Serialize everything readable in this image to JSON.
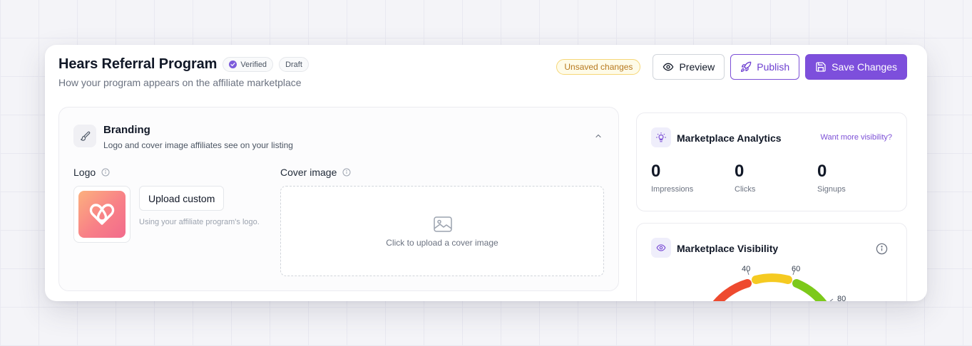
{
  "header": {
    "title": "Hears Referral Program",
    "badges": {
      "verified": "Verified",
      "draft": "Draft"
    },
    "subtitle": "How your program appears on the affiliate marketplace",
    "unsaved": "Unsaved changes",
    "preview_label": "Preview",
    "publish_label": "Publish",
    "save_label": "Save Changes"
  },
  "branding": {
    "title": "Branding",
    "description": "Logo and cover image affiliates see on your listing",
    "logo_label": "Logo",
    "upload_label": "Upload custom",
    "upload_hint": "Using your affiliate program's logo.",
    "cover_label": "Cover image",
    "cover_text": "Click to upload a cover image"
  },
  "analytics": {
    "title": "Marketplace Analytics",
    "link": "Want more visibility?",
    "stats": [
      {
        "value": "0",
        "label": "Impressions"
      },
      {
        "value": "0",
        "label": "Clicks"
      },
      {
        "value": "0",
        "label": "Signups"
      }
    ]
  },
  "visibility": {
    "title": "Marketplace Visibility",
    "gauge_ticks": [
      "40",
      "60",
      "80"
    ],
    "colors": {
      "red": "#ee4a2f",
      "yellow": "#f5ca21",
      "green": "#7cc91a"
    }
  },
  "colors": {
    "accent": "#7d4fdc",
    "warning_bg": "#fefbe8",
    "warning_text": "#b7791f"
  }
}
